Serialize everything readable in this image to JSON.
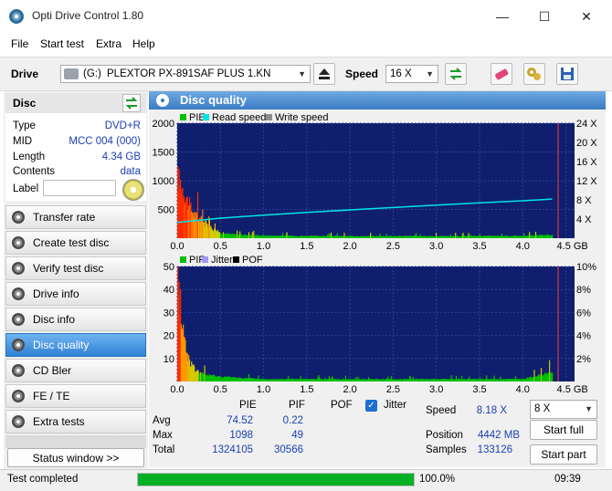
{
  "window": {
    "title": "Opti Drive Control 1.80",
    "minimize": "—",
    "maximize": "☐",
    "close": "✕"
  },
  "menu": [
    "File",
    "Start test",
    "Extra",
    "Help"
  ],
  "toolbar": {
    "drive_label": "Drive",
    "drive_letter": "(G:)",
    "drive_name": "PLEXTOR PX-891SAF PLUS 1.KN",
    "speed_label": "Speed",
    "speed_value": "16 X"
  },
  "disc": {
    "header": "Disc",
    "rows": [
      {
        "label": "Type",
        "value": "DVD+R"
      },
      {
        "label": "MID",
        "value": "MCC 004 (000)"
      },
      {
        "label": "Length",
        "value": "4.34 GB"
      },
      {
        "label": "Contents",
        "value": "data"
      }
    ],
    "label_label": "Label",
    "label_value": ""
  },
  "nav": [
    "Transfer rate",
    "Create test disc",
    "Verify test disc",
    "Drive info",
    "Disc info",
    "Disc quality",
    "CD Bler",
    "FE / TE",
    "Extra tests"
  ],
  "active_nav": "Disc quality",
  "status_window_button": "Status window >>",
  "content_title": "Disc quality",
  "stats": {
    "headers": {
      "pie": "PIE",
      "pif": "PIF",
      "pof": "POF",
      "jitter": "Jitter"
    },
    "jitter_checked": true,
    "rows": [
      {
        "label": "Avg",
        "pie": "74.52",
        "pif": "0.22"
      },
      {
        "label": "Max",
        "pie": "1098",
        "pif": "49"
      },
      {
        "label": "Total",
        "pie": "1324105",
        "pif": "30566"
      }
    ],
    "speed_label": "Speed",
    "speed_value": "8.18 X",
    "speed_select": "8 X",
    "position_label": "Position",
    "position_value": "4442 MB",
    "samples_label": "Samples",
    "samples_value": "133126",
    "start_full": "Start full",
    "start_part": "Start part"
  },
  "status": {
    "text": "Test completed",
    "progress_text": "100.0%",
    "progress": 1.0,
    "time": "09:39"
  },
  "chart_data": [
    {
      "type": "bar",
      "legend": [
        "PIE",
        "Read speed",
        "Write speed"
      ],
      "colors": {
        "PIE": "#00c000",
        "Read speed": "#00e5e5",
        "Write speed": "#8c8c8c"
      },
      "x_ticks": [
        "0.0",
        "0.5",
        "1.0",
        "1.5",
        "2.0",
        "2.5",
        "3.0",
        "3.5",
        "4.0",
        "4.5 GB"
      ],
      "y_ticks_left": [
        "2000",
        "1500",
        "1000",
        "500"
      ],
      "y_ticks_right": [
        "24 X",
        "20 X",
        "16 X",
        "12 X",
        "8 X",
        "4 X"
      ],
      "xlim": [
        0,
        4.6
      ],
      "ylim": [
        0,
        2000
      ],
      "y2lim": [
        0,
        24
      ],
      "pie_profile": [
        [
          0.0,
          1050
        ],
        [
          0.05,
          900
        ],
        [
          0.1,
          700
        ],
        [
          0.15,
          520
        ],
        [
          0.2,
          400
        ],
        [
          0.3,
          280
        ],
        [
          0.4,
          170
        ],
        [
          0.5,
          90
        ],
        [
          0.6,
          70
        ],
        [
          0.8,
          55
        ],
        [
          1.0,
          45
        ],
        [
          1.5,
          38
        ],
        [
          2.0,
          36
        ],
        [
          2.5,
          36
        ],
        [
          3.0,
          35
        ],
        [
          3.5,
          36
        ],
        [
          4.0,
          38
        ],
        [
          4.34,
          60
        ]
      ],
      "read_speed": [
        [
          0.0,
          3.3
        ],
        [
          0.5,
          4.2
        ],
        [
          1.0,
          4.8
        ],
        [
          1.5,
          5.4
        ],
        [
          2.0,
          5.9
        ],
        [
          2.5,
          6.4
        ],
        [
          3.0,
          6.9
        ],
        [
          3.5,
          7.4
        ],
        [
          4.0,
          7.8
        ],
        [
          4.34,
          8.18
        ]
      ]
    },
    {
      "type": "bar",
      "legend": [
        "PIF",
        "Jitter",
        "POF"
      ],
      "colors": {
        "PIF": "#00c000",
        "Jitter": "#9999ff",
        "POF": "#000000"
      },
      "x_ticks": [
        "0.0",
        "0.5",
        "1.0",
        "1.5",
        "2.0",
        "2.5",
        "3.0",
        "3.5",
        "4.0",
        "4.5 GB"
      ],
      "y_ticks_left": [
        "50",
        "40",
        "30",
        "20",
        "10"
      ],
      "y_ticks_right": [
        "10%",
        "8%",
        "6%",
        "4%",
        "2%"
      ],
      "xlim": [
        0,
        4.6
      ],
      "ylim": [
        0,
        50
      ],
      "y2lim": [
        0,
        10
      ],
      "pif_profile": [
        [
          0.0,
          49
        ],
        [
          0.03,
          34
        ],
        [
          0.07,
          20
        ],
        [
          0.1,
          13
        ],
        [
          0.15,
          8
        ],
        [
          0.2,
          5
        ],
        [
          0.3,
          3
        ],
        [
          0.5,
          2
        ],
        [
          1.0,
          1
        ],
        [
          2.0,
          1
        ],
        [
          3.0,
          1
        ],
        [
          4.0,
          1
        ],
        [
          4.34,
          4
        ]
      ]
    }
  ]
}
